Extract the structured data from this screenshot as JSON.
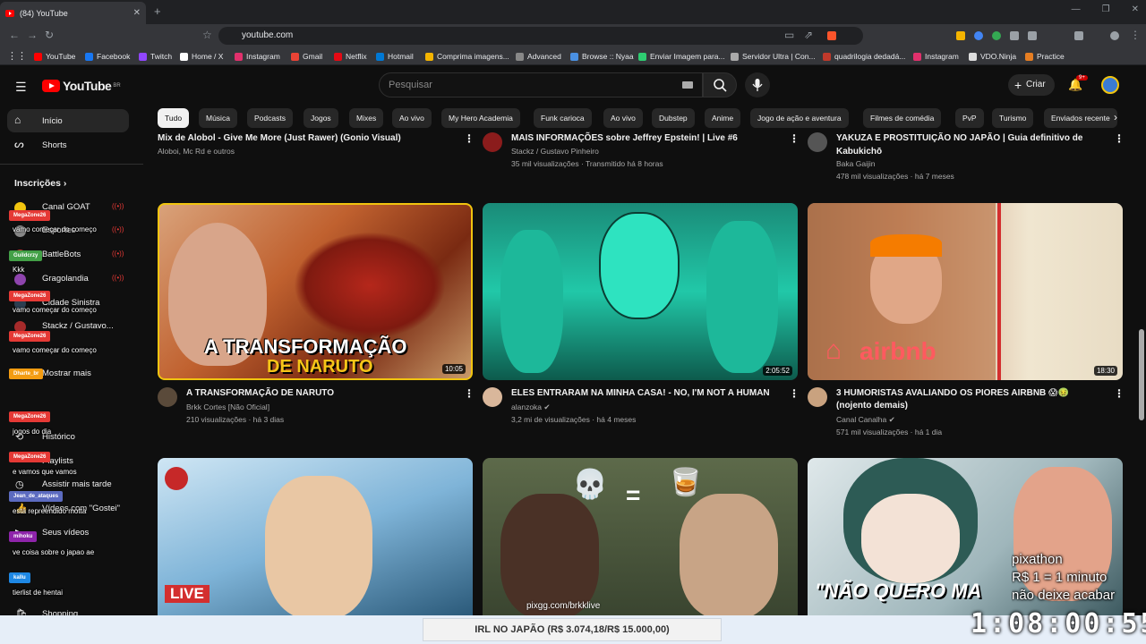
{
  "browser": {
    "tab_title": "(84) YouTube",
    "url": "youtube.com",
    "bookmarks": [
      {
        "label": "YouTube",
        "color": "#ff0000"
      },
      {
        "label": "Facebook",
        "color": "#1877f2"
      },
      {
        "label": "Twitch",
        "color": "#9146ff"
      },
      {
        "label": "Home / X",
        "color": "#ffffff"
      },
      {
        "label": "Instagram",
        "color": "#e1306c"
      },
      {
        "label": "Gmail",
        "color": "#ea4335"
      },
      {
        "label": "Netflix",
        "color": "#e50914"
      },
      {
        "label": "Hotmail",
        "color": "#0078d4"
      },
      {
        "label": "Comprima imagens...",
        "color": "#f4b400"
      },
      {
        "label": "Advanced",
        "color": "#888888"
      },
      {
        "label": "Browse :: Nyaa",
        "color": "#4a90e2"
      },
      {
        "label": "Enviar Imagem para...",
        "color": "#2ecc71"
      },
      {
        "label": "Servidor Ultra | Con...",
        "color": "#aaaaaa"
      },
      {
        "label": "quadrilogia dedadá...",
        "color": "#c0392b"
      },
      {
        "label": "Instagram",
        "color": "#e1306c"
      },
      {
        "label": "VDO.Ninja",
        "color": "#dddddd"
      },
      {
        "label": "Practice",
        "color": "#e67e22"
      }
    ]
  },
  "header": {
    "logo_text": "YouTube",
    "logo_region": "BR",
    "search_placeholder": "Pesquisar",
    "create_label": "Criar",
    "notif_count": "9+"
  },
  "chips": [
    "Tudo",
    "Música",
    "Podcasts",
    "Jogos",
    "Mixes",
    "Ao vivo",
    "My Hero Academia",
    "Funk carioca",
    "Ao vivo",
    "Dubstep",
    "Anime",
    "Jogo de ação e aventura",
    "Filmes de comédia",
    "PvP",
    "Turismo",
    "Enviados recente"
  ],
  "sidebar": {
    "home": "Início",
    "shorts": "Shorts",
    "subscriptions": "Inscrições",
    "subs": [
      "Canal GOAT",
      "Esportes",
      "BattleBots",
      "Gragolandia",
      "Cidade Sinistra",
      "Stackz / Gustavo...",
      "Mostrar mais"
    ],
    "you_items": [
      "Histórico",
      "Playlists",
      "Assistir mais tarde",
      "Vídeos com \"Gostei\"",
      "Seus vídeos",
      "Shopping"
    ]
  },
  "videos_top": [
    {
      "title": "Mix de Alobol - Give Me More (Just Rawer) (Gonio Visual)",
      "meta1": "Aloboi, Mc Rd e outros",
      "meta2": ""
    },
    {
      "title": "MAIS INFORMAÇÕES sobre Jeffrey Epstein! | Live #6",
      "meta1": "Stackz / Gustavo Pinheiro",
      "meta2": "35 mil visualizações · Transmitido há 8 horas"
    },
    {
      "title": "YAKUZA E PROSTITUIÇÃO NO JAPÃO | Guia definitivo de",
      "title2": "Kabukichō",
      "meta1": "Baka Gaijin",
      "meta2": "478 mil visualizações · há 7 meses"
    }
  ],
  "videos_mid": [
    {
      "title": "A TRANSFORMAÇÃO DE NARUTO",
      "channel": "Brkk Cortes [Não Oficial]",
      "meta": "210 visualizações · há 3 dias",
      "duration": "10:05",
      "overlay1": "A TRANSFORMAÇÃO",
      "overlay2": "DE NARUTO"
    },
    {
      "title": "ELES ENTRARAM NA MINHA CASA! - NO, I'M NOT A HUMAN",
      "channel": "alanzoka",
      "meta": "3,2 mi de visualizações · há 4 meses",
      "duration": "2:05:52"
    },
    {
      "title": "3 HUMORISTAS AVALIANDO OS PIORES AIRBNB 😱🤢",
      "title2": "(nojento demais)",
      "channel": "Canal Canalha",
      "meta": "571 mil visualizações · há 1 dia",
      "duration": "18:30",
      "overlay": "airbnb"
    }
  ],
  "videos_bottom": [
    {
      "overlay": "LIVE"
    },
    {
      "overlay": "pixgg.com/brkklive"
    },
    {
      "overlay": "\"NÃO QUERO MA"
    }
  ],
  "chat": [
    {
      "name": "MegaZone26",
      "msg": "vamo começar do começo",
      "color": "#e53935"
    },
    {
      "name": "Guildcrzy",
      "msg": "Kkk",
      "color": "#43a047"
    },
    {
      "name": "MegaZone26",
      "msg": "vamo começar do começo",
      "color": "#e53935"
    },
    {
      "name": "MegaZone26",
      "msg": "vamo começar do começo",
      "color": "#e53935"
    },
    {
      "name": "Dharte_br",
      "msg": "",
      "color": "#f39c12"
    },
    {
      "name": "MegaZone26",
      "msg": "jogos do dia",
      "color": "#e53935"
    },
    {
      "name": "MegaZone26",
      "msg": "e vamos que vamos",
      "color": "#e53935"
    },
    {
      "name": "Jean_de_ataques",
      "msg": "está repreendido motta",
      "color": "#5c6bc0"
    },
    {
      "name": "mihoku",
      "msg": "ve coisa sobre o japao ae",
      "color": "#8e24aa"
    },
    {
      "name": "kallu",
      "msg": "tierlist de hentai",
      "color": "#1e88e5"
    }
  ],
  "stream": {
    "goal": "IRL NO JAPÃO (R$ 3.074,18/R$ 15.000,00)",
    "pix_title": "pixathon",
    "pix_rate": "R$ 1 = 1 minuto",
    "pix_cta": "não deixe acabar",
    "timer": "1:08:00:55",
    "pix_url": "pixgg.com/brkklive"
  }
}
